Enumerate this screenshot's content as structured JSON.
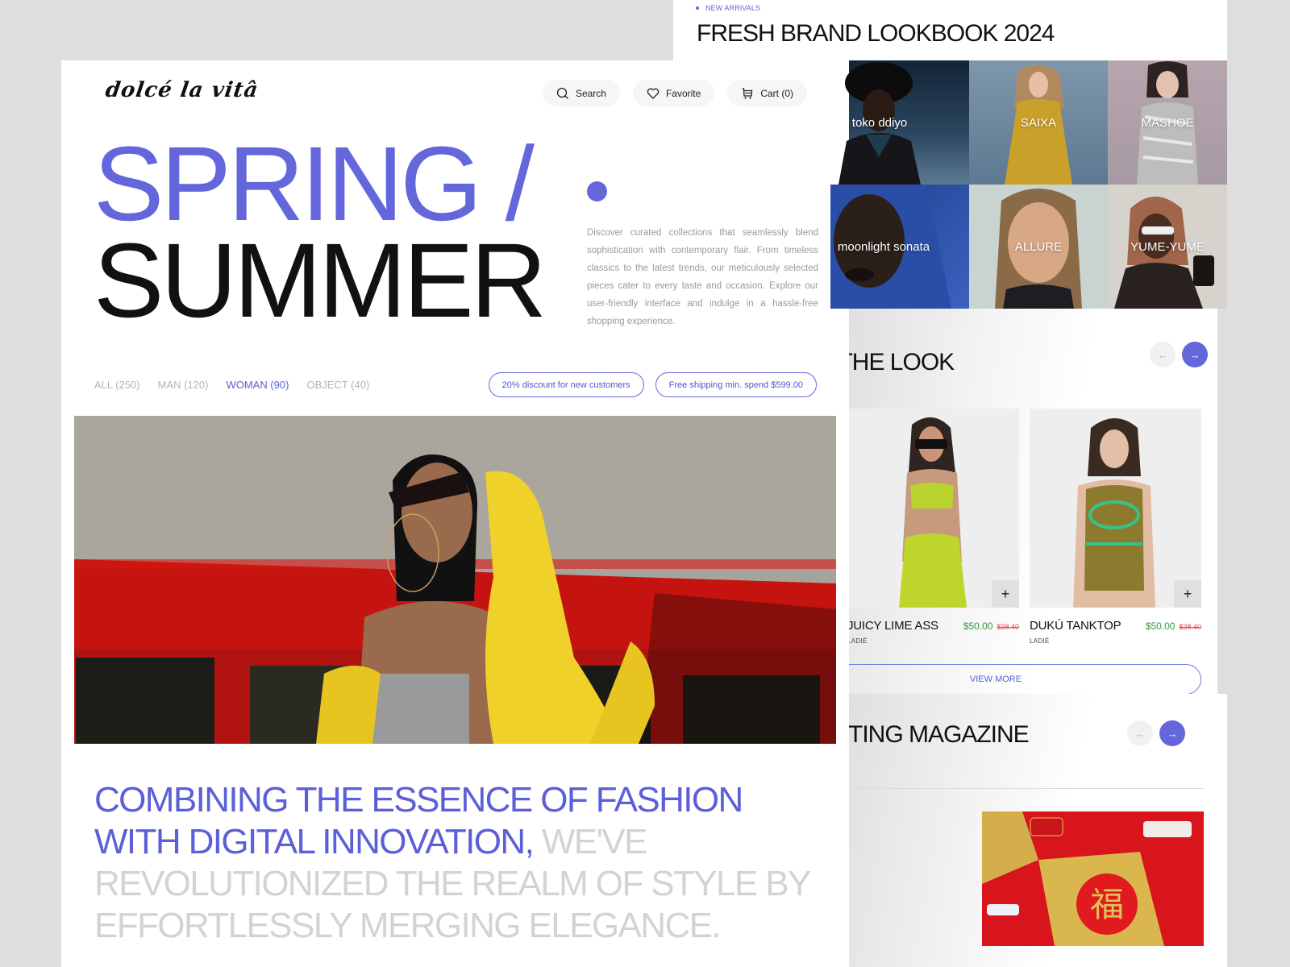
{
  "brand": {
    "logo_text": "dolcé la vitâ",
    "accent_color": "#6466dc"
  },
  "nav": {
    "search_label": "Search",
    "favorite_label": "Favorite",
    "cart_label": "Cart (0)"
  },
  "hero": {
    "title_line1": "SPRING /",
    "title_line2": "SUMMER",
    "description": "Discover curated collections that seamlessly blend sophistication with contemporary flair. From timeless classics to the latest trends, our meticulously selected pieces cater to every taste and occasion. Explore our user-friendly interface and indulge in a hassle-free shopping experience."
  },
  "filters": [
    {
      "label": "ALL (250)",
      "active": false
    },
    {
      "label": "MAN (120)",
      "active": false
    },
    {
      "label": "WOMAN (90)",
      "active": true
    },
    {
      "label": "OBJECT (40)",
      "active": false
    }
  ],
  "promos": [
    {
      "label": "20% discount for new customers"
    },
    {
      "label": "Free shipping min. spend $599.00"
    }
  ],
  "statement": {
    "highlight": "COMBINING THE ESSENCE OF FASHION WITH DIGITAL INNOVATION,",
    "rest": " WE'VE REVOLUTIONIZED THE REALM OF STYLE BY EFFORTLESSLY MERGING ELEGANCE."
  },
  "lookbook": {
    "eyebrow": "NEW ARRIVALS",
    "title": "FRESH BRAND LOOKBOOK 2024",
    "brands": [
      {
        "name": "toko ddiyo"
      },
      {
        "name": "SAIXA"
      },
      {
        "name": "MASHOE"
      },
      {
        "name": "moonlight sonata"
      },
      {
        "name": "ALLURE"
      },
      {
        "name": "YUME-YUME"
      }
    ]
  },
  "improving": {
    "title": "IMPROVING THE LOOK",
    "prev_icon": "arrow-left-icon",
    "next_icon": "arrow-right-icon",
    "partial_old_price": "$38.40",
    "products": [
      {
        "name": "JUICY LIME ASS",
        "category": "LADIÉ",
        "price": "$50.00",
        "old_price": "$38.40"
      },
      {
        "name": "DUKÚ TANKTOP",
        "category": "LADIÉ",
        "price": "$50.00",
        "old_price": "$38.40"
      }
    ],
    "view_more_label": "VIEW MORE"
  },
  "magazine": {
    "title": "INTERESTING MAGAZINE"
  }
}
